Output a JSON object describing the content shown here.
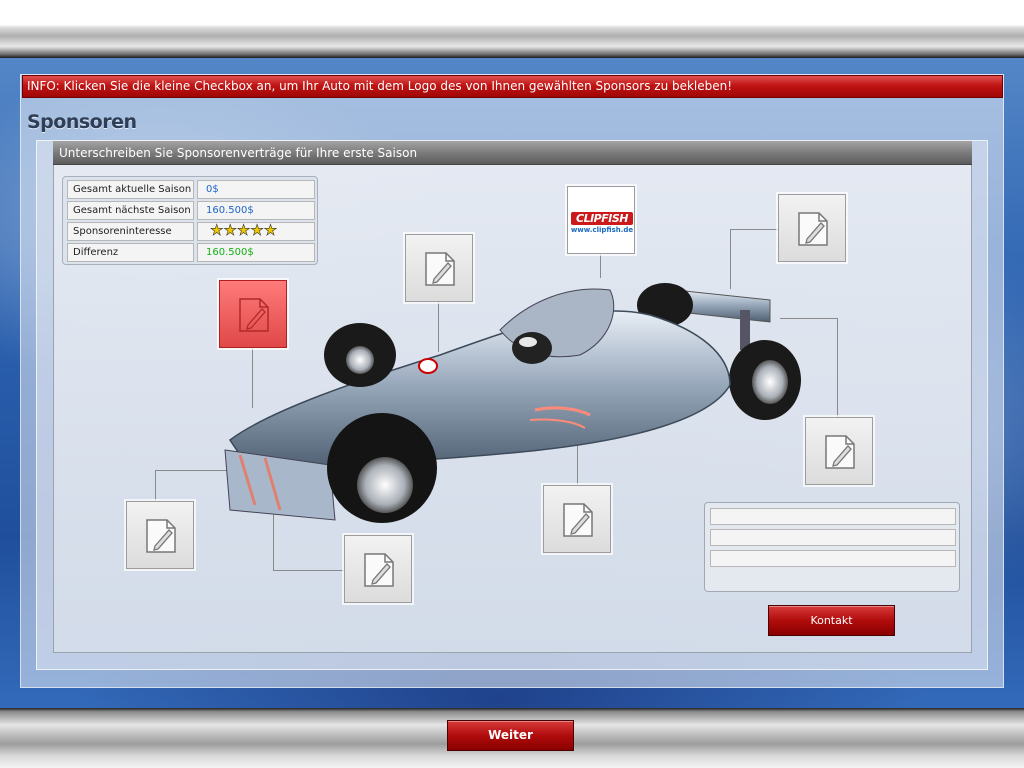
{
  "info": {
    "text": "INFO: Klicken Sie die kleine Checkbox an, um Ihr Auto mit dem Logo des von Ihnen gewählten Sponsors zu bekleben!"
  },
  "section": {
    "title": "Sponsoren"
  },
  "panel": {
    "header": "Unterschreiben Sie Sponsorenverträge für Ihre erste Saison"
  },
  "stats": [
    {
      "label": "Gesamt aktuelle Saison",
      "value": "0$",
      "color": "#1e64c8"
    },
    {
      "label": "Gesamt nächste Saison",
      "value": "160.500$",
      "color": "#1e64c8"
    },
    {
      "label": "Sponsoreninteresse",
      "rating": 5,
      "stars": "★★★★★"
    },
    {
      "label": "Differenz",
      "value": "160.500$",
      "color": "#12b012"
    }
  ],
  "sponsor_slots": [
    {
      "id": "slot-side-pod",
      "state": "selected"
    },
    {
      "id": "slot-nose-top",
      "state": "empty"
    },
    {
      "id": "slot-airbox",
      "state": "sponsor",
      "logo_text": "CLIPFISH",
      "logo_url": "www.clipfish.de"
    },
    {
      "id": "slot-rear-wing",
      "state": "empty"
    },
    {
      "id": "slot-rear-tyre",
      "state": "empty"
    },
    {
      "id": "slot-front-wing",
      "state": "empty"
    },
    {
      "id": "slot-front-nose",
      "state": "empty"
    },
    {
      "id": "slot-side-lower",
      "state": "empty"
    }
  ],
  "contact": {
    "lines": [
      "",
      "",
      ""
    ],
    "button_label": "Kontakt"
  },
  "footer": {
    "next_label": "Weiter"
  },
  "colors": {
    "accent_red": "#c01414",
    "selected_slot": "#e86464",
    "header_gray": "#7c7c7c"
  }
}
